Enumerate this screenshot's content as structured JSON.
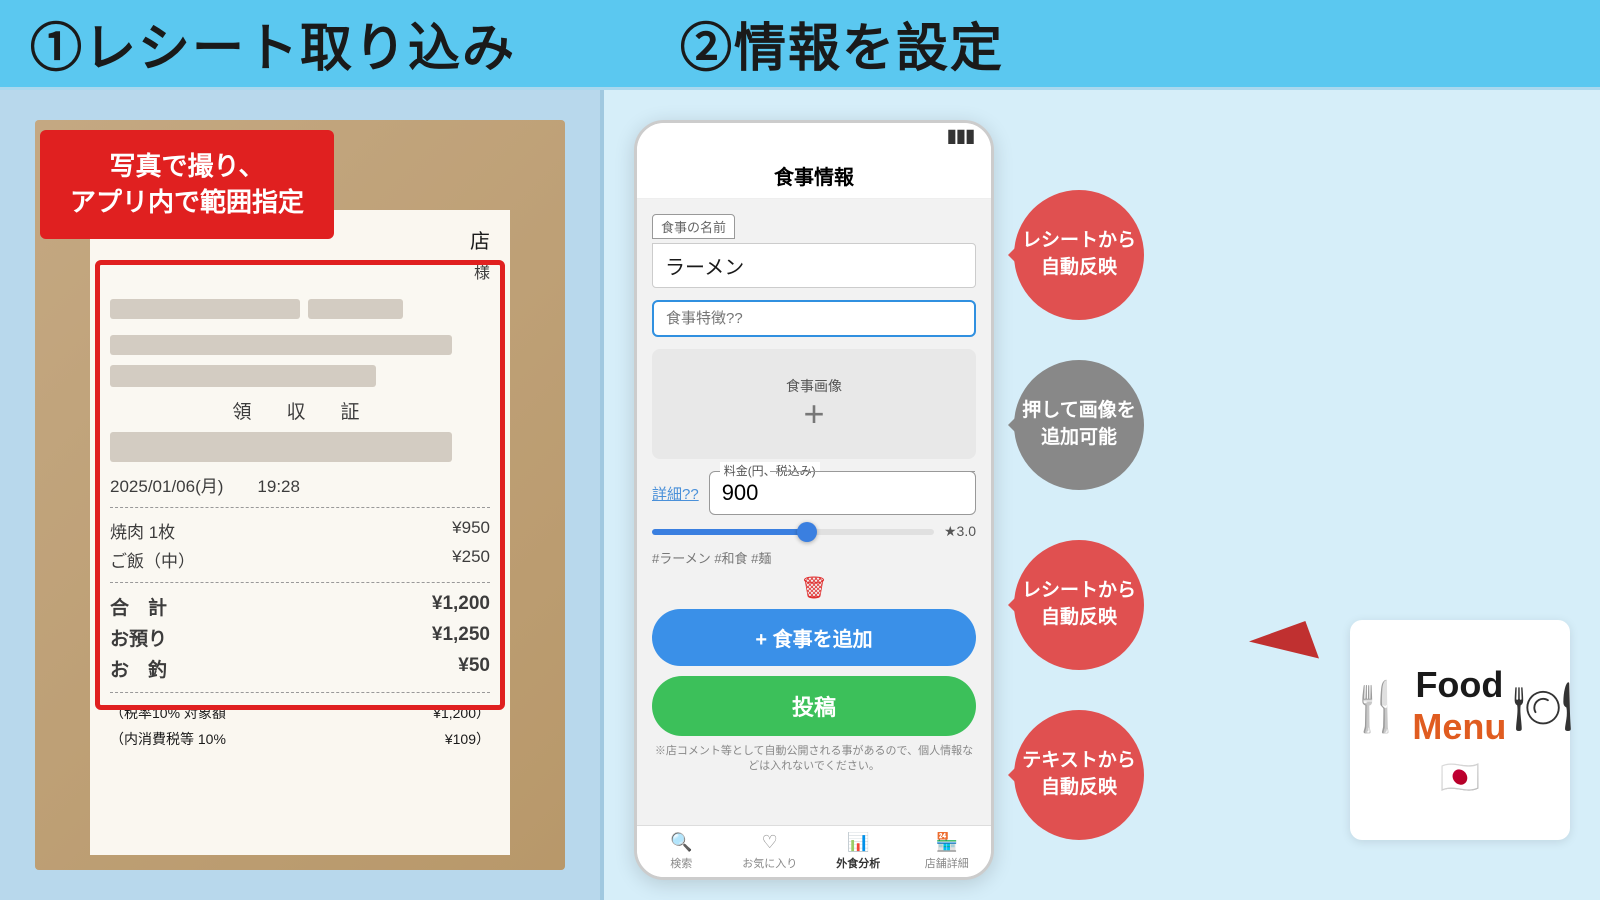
{
  "header": {
    "left_circle": "①",
    "left_title": "レシート取り込み",
    "right_circle": "②",
    "right_title": "情報を設定"
  },
  "left_panel": {
    "instruction_label": "写真で撮り、\nアプリ内で範囲指定",
    "receipt": {
      "shop_suffix": "店",
      "user_suffix": "様",
      "ryoshu_label": "領　収　証",
      "date": "2025/01/06(月)　　19:28",
      "items": [
        {
          "name": "焼肉 1枚",
          "price": "¥950"
        },
        {
          "name": "ご飯（中）",
          "price": "¥250"
        }
      ],
      "total_label": "合　計",
      "total_price": "¥1,200",
      "deposit_label": "お預り",
      "deposit_price": "¥1,250",
      "change_label": "お　釣",
      "change_price": "¥50",
      "tax_note1": "（税率10% 対象額",
      "tax_note1_val": "¥1,200）",
      "tax_note2": "（内消費税等 10%",
      "tax_note2_val": "¥109）"
    }
  },
  "right_panel": {
    "phone": {
      "header_title": "食事情報",
      "form": {
        "food_name_label": "食事の名前",
        "food_name_value": "ラーメン",
        "feature_placeholder": "食事特徴??",
        "image_label": "食事画像",
        "details_link": "詳細??",
        "price_label": "料金(円、税込み)",
        "price_value": "900",
        "rating_value": "★3.0",
        "hashtags": "#ラーメン #和食 #麺",
        "add_button": "+ 食事を追加",
        "post_button": "投稿",
        "disclaimer": "※店コメント等として自動公開される事があるので、個人情報などは入れないでください。"
      },
      "footer": [
        {
          "label": "検索",
          "icon": "🔍"
        },
        {
          "label": "お気に入り",
          "icon": "♡"
        },
        {
          "label": "外食分析",
          "icon": "📊",
          "active": true
        },
        {
          "label": "店舗詳細",
          "icon": "🏪"
        }
      ]
    },
    "bubbles": [
      {
        "text": "レシートから\n自動反映",
        "style": "red",
        "position": "top"
      },
      {
        "text": "押して画像を\n追加可能",
        "style": "gray",
        "position": "mid-top"
      },
      {
        "text": "レシートから\n自動反映",
        "style": "red",
        "position": "mid-bottom"
      },
      {
        "text": "テキストから\n自動反映",
        "style": "red",
        "position": "bottom"
      }
    ],
    "food_menu_card": {
      "food_text": "Food",
      "menu_text": "Menu"
    }
  }
}
